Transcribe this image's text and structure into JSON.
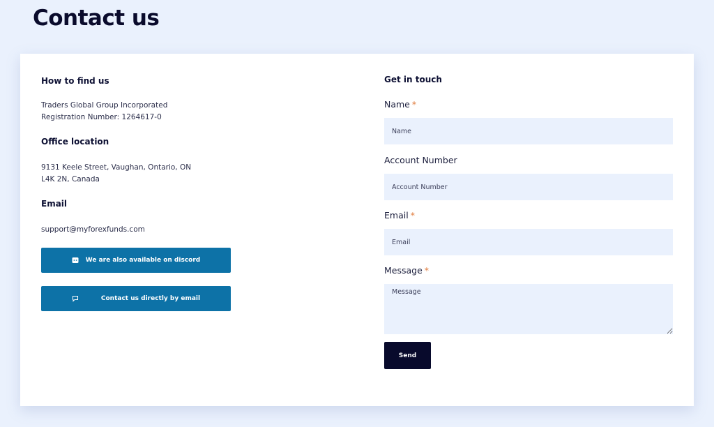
{
  "page": {
    "title": "Contact us"
  },
  "find_us": {
    "heading": "How to find us",
    "company": "Traders Global Group Incorporated",
    "registration": "Registration Number: 1264617-0"
  },
  "office": {
    "heading": "Office location",
    "address_line1": "9131 Keele Street, Vaughan, Ontario, ON",
    "address_line2": "L4K 2N, Canada"
  },
  "email_info": {
    "heading": "Email",
    "address": "support@myforexfunds.com"
  },
  "buttons": {
    "discord": {
      "label": "We are also available on discord",
      "icon": "discord-icon"
    },
    "email": {
      "label": "Contact us directly by email",
      "icon": "chat-bubble-icon"
    }
  },
  "form": {
    "heading": "Get in touch",
    "required_marker": "*",
    "name": {
      "label": "Name",
      "placeholder": "Name",
      "value": ""
    },
    "account": {
      "label": "Account Number",
      "placeholder": "Account Number",
      "value": ""
    },
    "email": {
      "label": "Email",
      "placeholder": "Email",
      "value": ""
    },
    "message": {
      "label": "Message",
      "placeholder": "Message",
      "value": ""
    },
    "send_label": "Send"
  },
  "colors": {
    "page_bg": "#eaf1fd",
    "button_blue": "#0d72a7",
    "send_dark": "#080a2c",
    "required_orange": "#e07b3c"
  }
}
